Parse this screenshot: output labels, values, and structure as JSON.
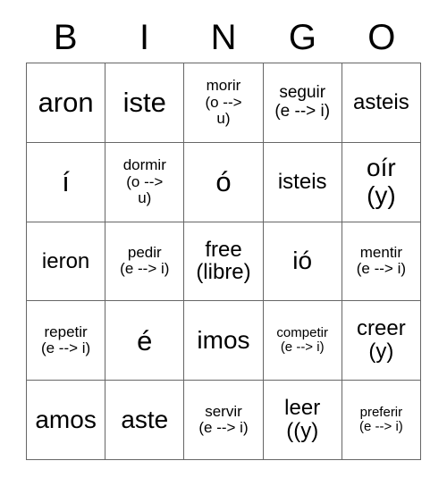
{
  "card": {
    "title": "BINGO card",
    "header_letters": [
      "B",
      "I",
      "N",
      "G",
      "O"
    ],
    "grid": {
      "rows": 5,
      "columns": 5,
      "border_color": "#666666",
      "background_color": "#ffffff",
      "text_color": "#000000"
    },
    "cells": [
      {
        "id": "B1",
        "text": "aron",
        "size": "fs-xl"
      },
      {
        "id": "I1",
        "text": "iste",
        "size": "fs-xl"
      },
      {
        "id": "N1",
        "text": "morir\n(o -->\nu)",
        "size": "fs-xs"
      },
      {
        "id": "G1",
        "text": "seguir\n(e --> i)",
        "size": "fs-sm"
      },
      {
        "id": "O1",
        "text": "asteis",
        "size": "fs-md"
      },
      {
        "id": "B2",
        "text": "í",
        "size": "fs-xl"
      },
      {
        "id": "I2",
        "text": "dormir\n(o -->\nu)",
        "size": "fs-xs"
      },
      {
        "id": "N2",
        "text": "ó",
        "size": "fs-xl"
      },
      {
        "id": "G2",
        "text": "isteis",
        "size": "fs-md"
      },
      {
        "id": "O2",
        "text": "oír\n(y)",
        "size": "fs-lg"
      },
      {
        "id": "B3",
        "text": "ieron",
        "size": "fs-md"
      },
      {
        "id": "I3",
        "text": "pedir\n(e --> i)",
        "size": "fs-xs"
      },
      {
        "id": "N3",
        "text": "free\n(libre)",
        "size": "fs-md"
      },
      {
        "id": "G3",
        "text": "ió",
        "size": "fs-lg"
      },
      {
        "id": "O3",
        "text": "mentir\n(e --> i)",
        "size": "fs-xs"
      },
      {
        "id": "B4",
        "text": "repetir\n(e --> i)",
        "size": "fs-xs"
      },
      {
        "id": "I4",
        "text": "é",
        "size": "fs-xl"
      },
      {
        "id": "N4",
        "text": "imos",
        "size": "fs-lg"
      },
      {
        "id": "G4",
        "text": "competir\n(e --> i)",
        "size": "fs-xxs"
      },
      {
        "id": "O4",
        "text": "creer\n(y)",
        "size": "fs-md"
      },
      {
        "id": "B5",
        "text": "amos",
        "size": "fs-lg"
      },
      {
        "id": "I5",
        "text": "aste",
        "size": "fs-lg"
      },
      {
        "id": "N5",
        "text": "servir\n(e --> i)",
        "size": "fs-xs"
      },
      {
        "id": "G5",
        "text": "leer\n((y)",
        "size": "fs-md"
      },
      {
        "id": "O5",
        "text": "preferir\n(e --> i)",
        "size": "fs-xxs"
      }
    ]
  }
}
